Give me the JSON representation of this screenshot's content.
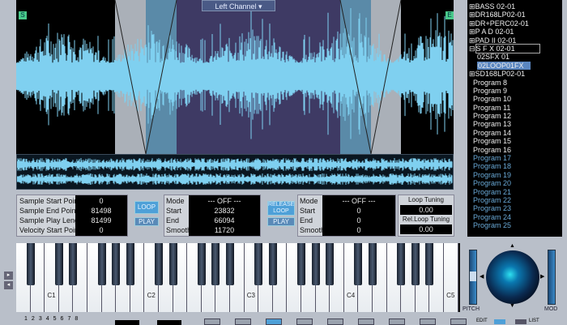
{
  "waveform": {
    "channel_select": "Left Channel",
    "start_marker": "S",
    "end_marker": "E"
  },
  "sample": {
    "labels": [
      "Sample Start Point",
      "Sample End Point",
      "Sample Play Length",
      "Velocity Start Point"
    ],
    "values": [
      "0",
      "81498",
      "81499",
      "0"
    ]
  },
  "loop": {
    "loop_label": "LOOP",
    "play_label": "PLAY",
    "field_labels": [
      "Mode",
      "Start",
      "End",
      "Smooth"
    ],
    "values": [
      "--- OFF ---",
      "23832",
      "66094",
      "11720"
    ]
  },
  "release_loop": {
    "loop_label": "RELEASE LOOP",
    "play_label": "PLAY",
    "field_labels": [
      "Mode",
      "Start",
      "End",
      "Smooth"
    ],
    "values": [
      "--- OFF ---",
      "0",
      "0",
      "0"
    ]
  },
  "tuning": {
    "loop_tuning_label": "Loop Tuning",
    "loop_tuning_value": "0.00",
    "rel_loop_tuning_label": "Rel.Loop Tuning",
    "rel_loop_tuning_value": "0.00"
  },
  "tree": [
    {
      "label": "BASS  02-01",
      "type": "folder"
    },
    {
      "label": "DR168LP02-01",
      "type": "folder"
    },
    {
      "label": "DR+PERC02-01",
      "type": "folder"
    },
    {
      "label": "P A D  02-01",
      "type": "folder"
    },
    {
      "label": "PAD II 02-01",
      "type": "folder"
    },
    {
      "label": "S F X  02-01",
      "type": "open"
    },
    {
      "label": "02SFX 01",
      "type": "child"
    },
    {
      "label": "02LOOP01FX",
      "type": "selected"
    },
    {
      "label": "SD168LP02-01",
      "type": "folder"
    },
    {
      "label": "Program 8",
      "type": "prog"
    },
    {
      "label": "Program 9",
      "type": "prog"
    },
    {
      "label": "Program 10",
      "type": "prog"
    },
    {
      "label": "Program 11",
      "type": "prog"
    },
    {
      "label": "Program 12",
      "type": "prog"
    },
    {
      "label": "Program 13",
      "type": "prog"
    },
    {
      "label": "Program 14",
      "type": "prog"
    },
    {
      "label": "Program 15",
      "type": "prog"
    },
    {
      "label": "Program 16",
      "type": "prog"
    },
    {
      "label": "Program 17",
      "type": "dim"
    },
    {
      "label": "Program 18",
      "type": "dim"
    },
    {
      "label": "Program 19",
      "type": "dim"
    },
    {
      "label": "Program 20",
      "type": "dim"
    },
    {
      "label": "Program 21",
      "type": "dim"
    },
    {
      "label": "Program 22",
      "type": "dim"
    },
    {
      "label": "Program 23",
      "type": "dim"
    },
    {
      "label": "Program 24",
      "type": "dim"
    },
    {
      "label": "Program 25",
      "type": "dim"
    }
  ],
  "keyboard": {
    "octave_labels": [
      "C1",
      "C2",
      "C3",
      "C4",
      "C5"
    ]
  },
  "controls": {
    "pitch_label": "PITCH",
    "mod_label": "MOD",
    "edit_label": "EDIT",
    "list_label": "LIST",
    "channels": [
      "1",
      "2",
      "3",
      "4",
      "5",
      "6",
      "7",
      "8"
    ]
  },
  "colors": {
    "wave": "#7fd0f0",
    "accent": "#4ea0d8"
  }
}
